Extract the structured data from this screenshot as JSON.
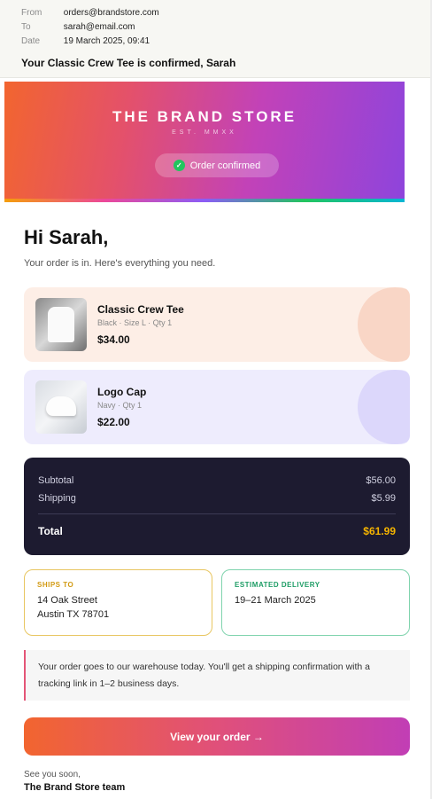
{
  "email_meta": {
    "from_label": "From",
    "from_value": "orders@brandstore.com",
    "to_label": "To",
    "to_value": "sarah@email.com",
    "date_label": "Date",
    "date_value": "19 March 2025, 09:41",
    "subject": "Your Classic Crew Tee is confirmed, Sarah"
  },
  "hero": {
    "brand": "THE BRAND STORE",
    "established": "EST. MMXX",
    "status_pill": "Order confirmed",
    "check_icon": "check-circle-icon"
  },
  "body": {
    "greeting": "Hi Sarah,",
    "intro": "Your order is in. Here's everything you need."
  },
  "items": [
    {
      "name": "Classic Crew Tee",
      "details": "Black · Size L · Qty 1",
      "price": "$34.00",
      "image_icon": "tshirt-image"
    },
    {
      "name": "Logo Cap",
      "details": "Navy · Qty 1",
      "price": "$22.00",
      "image_icon": "cap-image"
    }
  ],
  "summary": {
    "subtotal_label": "Subtotal",
    "subtotal_value": "$56.00",
    "shipping_label": "Shipping",
    "shipping_value": "$5.99",
    "total_label": "Total",
    "total_value": "$61.99"
  },
  "ships_to": {
    "label": "SHIPS TO",
    "line1": "14 Oak Street",
    "line2": "Austin TX 78701"
  },
  "delivery": {
    "label": "ESTIMATED DELIVERY",
    "value": "19–21 March 2025"
  },
  "notice": "Your order goes to our warehouse today. You'll get a shipping confirmation with a tracking link in 1–2 business days.",
  "cta_label": "View your order →",
  "signoff": "See you soon,",
  "team": "The Brand Store team",
  "colors": {
    "accent_orange": "#f2652f",
    "accent_purple": "#8e44dc",
    "summary_bg": "#1d1b30",
    "total_gold": "#f5b400"
  }
}
